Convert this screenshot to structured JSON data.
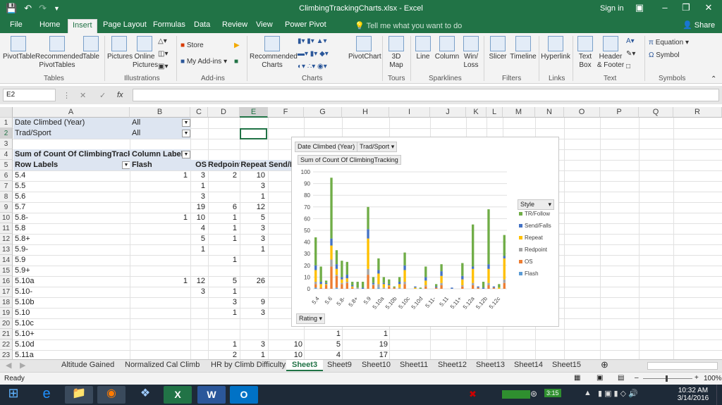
{
  "window": {
    "title": "ClimbingTrackingCharts.xlsx - Excel",
    "signin": "Sign in"
  },
  "ribbon_tabs": [
    "File",
    "Home",
    "Insert",
    "Page Layout",
    "Formulas",
    "Data",
    "Review",
    "View",
    "Power Pivot"
  ],
  "tell_me": "Tell me what you want to do",
  "share": "Share",
  "ribbon": {
    "pivottable": "PivotTable",
    "recommended_pivottables": [
      "Recommended",
      "PivotTables"
    ],
    "table": "Table",
    "group_tables": "Tables",
    "pictures": "Pictures",
    "online_pictures": [
      "Online",
      "Pictures"
    ],
    "group_illustrations": "Illustrations",
    "store": "Store",
    "my_addins": "My Add-ins",
    "group_addins": "Add-ins",
    "recommended_charts": [
      "Recommended",
      "Charts"
    ],
    "pivotchart": "PivotChart",
    "map3d": [
      "3D",
      "Map"
    ],
    "group_charts": "Charts",
    "group_tours": "Tours",
    "line": "Line",
    "column": "Column",
    "winloss": [
      "Win/",
      "Loss"
    ],
    "group_sparklines": "Sparklines",
    "slicer": "Slicer",
    "timeline": "Timeline",
    "group_filters": "Filters",
    "hyperlink": "Hyperlink",
    "group_links": "Links",
    "textbox": [
      "Text",
      "Box"
    ],
    "header_footer": [
      "Header",
      "& Footer"
    ],
    "group_text": "Text",
    "equation": "Equation",
    "symbol": "Symbol",
    "group_symbols": "Symbols"
  },
  "namebox": "E2",
  "columns": [
    "A",
    "B",
    "C",
    "D",
    "E",
    "F",
    "G",
    "H",
    "I",
    "J",
    "K",
    "L",
    "M",
    "N",
    "O",
    "P",
    "Q",
    "R"
  ],
  "rows": [
    "1",
    "2",
    "3",
    "4",
    "5",
    "6",
    "7",
    "8",
    "9",
    "10",
    "11",
    "12",
    "13",
    "14",
    "15",
    "16",
    "17",
    "18",
    "19",
    "20",
    "21",
    "22",
    "23"
  ],
  "pivot": {
    "filter1_label": "Date Climbed (Year)",
    "filter1_value": "All",
    "filter2_label": "Trad/Sport",
    "filter2_value": "All",
    "values_header": "Sum of Count Of ClimbingTracking",
    "column_labels": "Column Labels",
    "row_labels": "Row Labels",
    "col_headers": [
      "Flash",
      "OS",
      "Redpoint",
      "Repeat",
      "Send/F"
    ],
    "row_names": [
      "5.4",
      "5.5",
      "5.6",
      "5.7",
      "5.8-",
      "5.8",
      "5.8+",
      "5.9-",
      "5.9",
      "5.9+",
      "5.10a",
      "5.10-",
      "5.10b",
      "5.10",
      "5.10c",
      "5.10+",
      "5.10d",
      "5.11a"
    ],
    "data": [
      [
        "1",
        "3",
        "2",
        "10"
      ],
      [
        "",
        "1",
        "",
        "3"
      ],
      [
        "",
        "3",
        "",
        "1"
      ],
      [
        "",
        "19",
        "6",
        "12"
      ],
      [
        "1",
        "10",
        "1",
        "5"
      ],
      [
        "",
        "4",
        "1",
        "3"
      ],
      [
        "",
        "5",
        "1",
        "3"
      ],
      [
        "",
        "1",
        "",
        "1"
      ],
      [
        "",
        "",
        "1",
        ""
      ],
      [
        "",
        "",
        "",
        ""
      ],
      [
        "1",
        "12",
        "5",
        "26"
      ],
      [
        "",
        "3",
        "1",
        ""
      ],
      [
        "",
        "",
        "3",
        "9"
      ],
      [
        "",
        "",
        "1",
        "3"
      ],
      [
        "",
        "",
        "",
        ""
      ],
      [
        "",
        "",
        "",
        ""
      ],
      [
        "",
        "",
        "1",
        "3"
      ],
      [
        "",
        "",
        "2",
        "1"
      ]
    ],
    "row21_g": "1",
    "row21_h": "1",
    "row22_f": "10",
    "row22_g": "5",
    "row22_h": "19",
    "row23_f": "10",
    "row23_g": "4",
    "row23_h": "17"
  },
  "chart_data": {
    "type": "bar",
    "stacked": true,
    "filter_buttons": [
      "Date Climbed (Year)",
      "Trad/Sport"
    ],
    "value_label": "Sum of Count Of ClimbingTracking",
    "axis_button": "Rating",
    "legend_title": "Style",
    "ylim": [
      0,
      100
    ],
    "yticks": [
      "0",
      "10",
      "20",
      "30",
      "40",
      "50",
      "60",
      "70",
      "80",
      "90",
      "100"
    ],
    "x_tick_labels": [
      "5.4",
      "5.6",
      "5.8-",
      "5.8+",
      "5.9",
      "5.10a",
      "5.10b",
      "5.10c",
      "5.10d",
      "5.11-",
      "5.11",
      "5.11+",
      "5.12a",
      "5.12b",
      "5.12c"
    ],
    "grid": true,
    "legend_position": "right",
    "series": [
      {
        "name": "Flash",
        "color": "#5b9bd5",
        "values": [
          1,
          0,
          0,
          0,
          1,
          0,
          0,
          0,
          0,
          0,
          0,
          0,
          1,
          0,
          0,
          0,
          0,
          0,
          0,
          0,
          0,
          0,
          0,
          0,
          0,
          0,
          0,
          0,
          0,
          0,
          0,
          0,
          0,
          0,
          0,
          0,
          0
        ]
      },
      {
        "name": "OS",
        "color": "#ed7d31",
        "values": [
          3,
          1,
          3,
          19,
          10,
          4,
          5,
          1,
          0,
          0,
          12,
          3,
          0,
          0,
          2,
          1,
          0,
          4,
          0,
          0,
          0,
          2,
          0,
          1,
          3,
          0,
          0,
          0,
          2,
          0,
          3,
          1,
          0,
          3,
          1,
          0,
          5
        ]
      },
      {
        "name": "Redpoint",
        "color": "#a5a5a5",
        "values": [
          2,
          0,
          0,
          6,
          1,
          1,
          1,
          0,
          1,
          0,
          5,
          1,
          3,
          1,
          0,
          0,
          1,
          2,
          0,
          0,
          0,
          1,
          0,
          0,
          2,
          0,
          0,
          0,
          1,
          0,
          2,
          0,
          0,
          2,
          0,
          0,
          3
        ]
      },
      {
        "name": "Repeat",
        "color": "#ffc000",
        "values": [
          10,
          3,
          1,
          12,
          5,
          3,
          3,
          1,
          0,
          0,
          26,
          0,
          9,
          3,
          1,
          0,
          3,
          10,
          0,
          1,
          0,
          4,
          0,
          0,
          6,
          0,
          0,
          0,
          5,
          0,
          12,
          0,
          0,
          12,
          0,
          1,
          18
        ]
      },
      {
        "name": "Send/Falls",
        "color": "#4472c4",
        "values": [
          4,
          2,
          1,
          6,
          4,
          2,
          3,
          1,
          0,
          1,
          8,
          1,
          3,
          1,
          1,
          0,
          2,
          4,
          0,
          1,
          0,
          3,
          0,
          1,
          4,
          0,
          1,
          0,
          3,
          0,
          2,
          1,
          1,
          4,
          1,
          0,
          2
        ]
      },
      {
        "name": "TR/Follow",
        "color": "#70ad47",
        "values": [
          24,
          13,
          2,
          52,
          12,
          14,
          11,
          3,
          5,
          5,
          19,
          5,
          10,
          5,
          4,
          1,
          4,
          11,
          0,
          0,
          1,
          9,
          0,
          2,
          6,
          0,
          0,
          0,
          11,
          0,
          36,
          0,
          5,
          47,
          0,
          3,
          18
        ]
      }
    ]
  },
  "sheet_tabs": [
    "Altitude Gained",
    "Normalized Cal Climb",
    "HR by Climb Difficulty",
    "Sheet3",
    "Sheet9",
    "Sheet10",
    "Sheet11",
    "Sheet12",
    "Sheet13",
    "Sheet14",
    "Sheet15"
  ],
  "active_sheet": "Sheet3",
  "status": {
    "left": "Ready",
    "zoom": "100%"
  },
  "taskbar": {
    "time": "10:32 AM",
    "date": "3/14/2016",
    "battery": "3:15"
  }
}
